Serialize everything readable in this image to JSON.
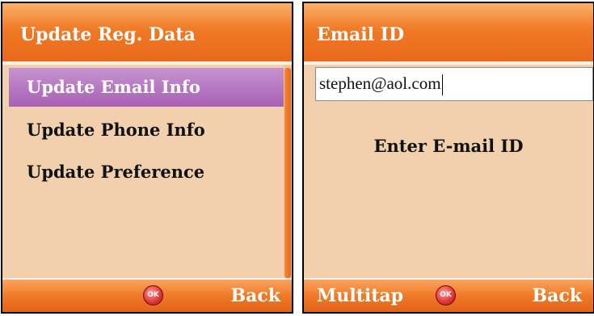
{
  "left_screen": {
    "title": "Update Reg. Data",
    "menu_items": [
      {
        "label": "Update Email Info",
        "selected": true
      },
      {
        "label": "Update Phone Info",
        "selected": false
      },
      {
        "label": "Update Preference",
        "selected": false
      }
    ],
    "softkeys": {
      "center_icon": "ok-icon",
      "center_label": "OK",
      "right_label": "Back"
    }
  },
  "right_screen": {
    "title": "Email ID",
    "email_input": {
      "value": "stephen@aol.com"
    },
    "prompt": "Enter E-mail ID",
    "softkeys": {
      "left_label": "Multitap",
      "center_icon": "ok-icon",
      "center_label": "OK",
      "right_label": "Back"
    }
  },
  "colors": {
    "title_bar": "#f07a26",
    "background": "#f2cfad",
    "selection": "#a760b5",
    "ok_button": "#e33a3a"
  }
}
